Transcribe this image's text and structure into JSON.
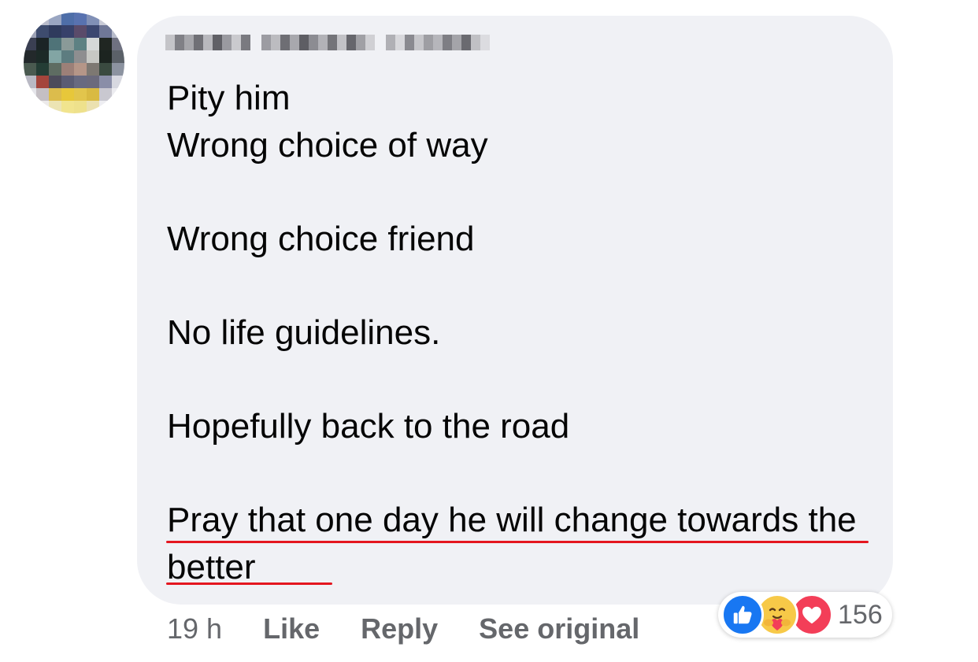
{
  "comment": {
    "text": "Pity him\nWrong choice of way\n\nWrong choice friend\n\nNo life guidelines.\n\nHopefully back to the road\n\nPray that one day he will change towards the better"
  },
  "footer": {
    "timestamp": "19 h",
    "like_label": "Like",
    "reply_label": "Reply",
    "see_original_label": "See original"
  },
  "reactions": {
    "icons": [
      "thumbs-up-icon",
      "care-hug-icon",
      "heart-icon"
    ],
    "count": "156"
  },
  "colors": {
    "bubble": "#f0f1f5",
    "text": "#050505",
    "secondary_text": "#65676b",
    "like_blue": "#1877f2",
    "love_red": "#f33e58",
    "care_yellow": "#f7c948",
    "annotation_underline": "#e4161f"
  }
}
